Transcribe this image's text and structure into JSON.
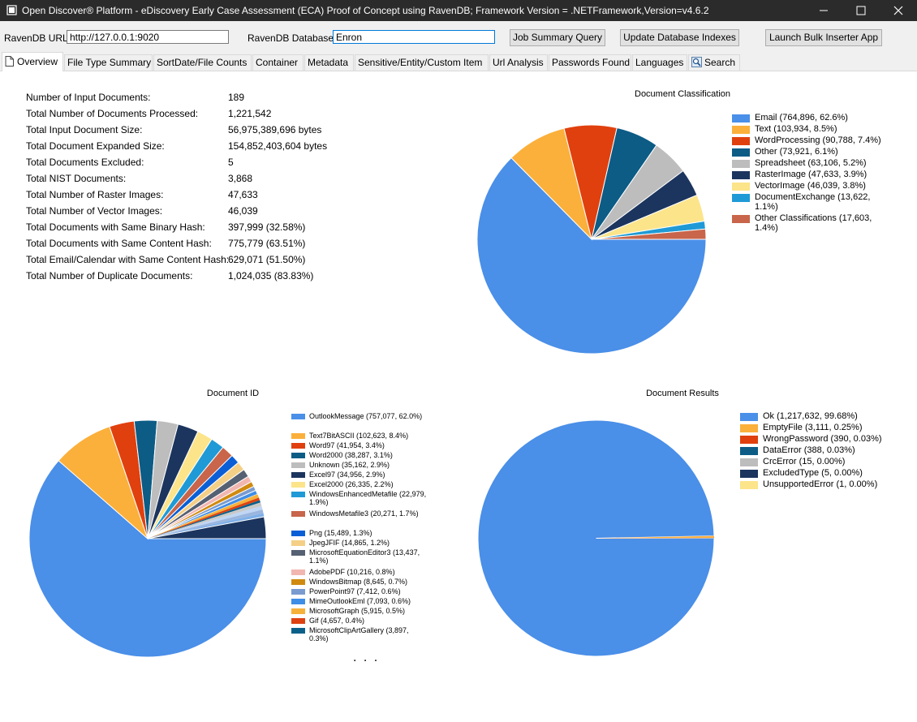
{
  "window": {
    "title": "Open Discover® Platform - eDiscovery Early Case Assessment (ECA) Proof of Concept using RavenDB;   Framework Version = .NETFramework,Version=v4.6.2"
  },
  "toolbar": {
    "ravendb_url_label": "RavenDB URL:",
    "ravendb_url_value": "http://127.0.0.1:9020",
    "ravendb_db_label": "RavenDB Database:",
    "ravendb_db_value": "Enron",
    "job_summary_button": "Job Summary Query",
    "update_indexes_button": "Update Database Indexes",
    "bulk_inserter_button": "Launch Bulk Inserter App"
  },
  "tabs": [
    {
      "label": "Overview",
      "icon": "document-icon",
      "active": true
    },
    {
      "label": "File Type Summary"
    },
    {
      "label": "SortDate/File Counts"
    },
    {
      "label": "Container"
    },
    {
      "label": "Metadata"
    },
    {
      "label": "Sensitive/Entity/Custom Item"
    },
    {
      "label": "Url Analysis"
    },
    {
      "label": "Passwords Found"
    },
    {
      "label": "Languages"
    },
    {
      "label": "Search",
      "icon": "search-icon"
    }
  ],
  "stats": [
    {
      "label": "Number of Input Documents:",
      "value": "189"
    },
    {
      "label": "Total Number of Documents Processed:",
      "value": "1,221,542"
    },
    {
      "label": "Total Input Document Size:",
      "value": "56,975,389,696 bytes"
    },
    {
      "label": "Total Document Expanded Size:",
      "value": "154,852,403,604 bytes"
    },
    {
      "label": "Total Documents Excluded:",
      "value": "5"
    },
    {
      "label": "Total NIST Documents:",
      "value": "3,868"
    },
    {
      "label": "Total Number of Raster Images:",
      "value": "47,633"
    },
    {
      "label": "Total Number of Vector Images:",
      "value": "46,039"
    },
    {
      "label": "Total Documents with Same Binary Hash:",
      "value": "397,999 (32.58%)"
    },
    {
      "label": "Total Documents with Same Content Hash:",
      "value": "775,779 (63.51%)"
    },
    {
      "label": "Total Email/Calendar with Same Content Hash:",
      "value": "629,071 (51.50%)"
    },
    {
      "label": "Total Number of Duplicate Documents:",
      "value": "1,024,035 (83.83%)"
    }
  ],
  "chart_data": [
    {
      "type": "pie",
      "title": "Document Classification",
      "legend": "right",
      "series": [
        {
          "name": "Email",
          "value": 764896,
          "label": "Email (764,896, 62.6%)",
          "color": "#4a8fe8"
        },
        {
          "name": "Text",
          "value": 103934,
          "label": "Text (103,934, 8.5%)",
          "color": "#fbb03b"
        },
        {
          "name": "WordProcessing",
          "value": 90788,
          "label": "WordProcessing (90,788, 7.4%)",
          "color": "#e0400e"
        },
        {
          "name": "Other",
          "value": 73921,
          "label": "Other (73,921, 6.1%)",
          "color": "#0c5c86"
        },
        {
          "name": "Spreadsheet",
          "value": 63106,
          "label": "Spreadsheet (63,106, 5.2%)",
          "color": "#bdbdbd"
        },
        {
          "name": "RasterImage",
          "value": 47633,
          "label": "RasterImage (47,633, 3.9%)",
          "color": "#1c355e"
        },
        {
          "name": "VectorImage",
          "value": 46039,
          "label": "VectorImage (46,039, 3.8%)",
          "color": "#fce48a"
        },
        {
          "name": "DocumentExchange",
          "value": 13622,
          "label": "DocumentExchange (13,622, 1.1%)",
          "color": "#1f9ad6"
        },
        {
          "name": "Other Classifications",
          "value": 17603,
          "label": "Other Classifications (17,603, 1.4%)",
          "color": "#c8654a"
        }
      ]
    },
    {
      "type": "pie",
      "title": "Document ID",
      "legend": "right",
      "series": [
        {
          "name": "OutlookMessage",
          "value": 757077,
          "label": "OutlookMessage (757,077, 62.0%)",
          "color": "#4a8fe8"
        },
        {
          "name": "Text7BitASCII",
          "value": 102623,
          "label": "Text7BitASCII (102,623, 8.4%)",
          "color": "#fbb03b"
        },
        {
          "name": "Word97",
          "value": 41954,
          "label": "Word97 (41,954, 3.4%)",
          "color": "#e0400e"
        },
        {
          "name": "Word2000",
          "value": 38287,
          "label": "Word2000 (38,287, 3.1%)",
          "color": "#0c5c86"
        },
        {
          "name": "Unknown",
          "value": 35162,
          "label": "Unknown (35,162, 2.9%)",
          "color": "#bdbdbd"
        },
        {
          "name": "Excel97",
          "value": 34956,
          "label": "Excel97 (34,956, 2.9%)",
          "color": "#1c355e"
        },
        {
          "name": "Excel2000",
          "value": 26335,
          "label": "Excel2000 (26,335, 2.2%)",
          "color": "#fce48a"
        },
        {
          "name": "WindowsEnhancedMetafile",
          "value": 22979,
          "label": "WindowsEnhancedMetafile (22,979, 1.9%)",
          "color": "#1f9ad6"
        },
        {
          "name": "WindowsMetafile3",
          "value": 20271,
          "label": "WindowsMetafile3 (20,271, 1.7%)",
          "color": "#c8654a"
        },
        {
          "name": "Png",
          "value": 15489,
          "label": "Png (15,489, 1.3%)",
          "color": "#0b5fd6"
        },
        {
          "name": "JpegJFIF",
          "value": 14865,
          "label": "JpegJFIF (14,865, 1.2%)",
          "color": "#f4cf86"
        },
        {
          "name": "MicrosoftEquationEditor3",
          "value": 13437,
          "label": "MicrosoftEquationEditor3 (13,437, 1.1%)",
          "color": "#556172"
        },
        {
          "name": "AdobePDF",
          "value": 10216,
          "label": "AdobePDF (10,216, 0.8%)",
          "color": "#f2b6b0"
        },
        {
          "name": "WindowsBitmap",
          "value": 8645,
          "label": "WindowsBitmap (8,645, 0.7%)",
          "color": "#d08a10"
        },
        {
          "name": "PowerPoint97",
          "value": 7412,
          "label": "PowerPoint97 (7,412, 0.6%)",
          "color": "#7a9bd0"
        },
        {
          "name": "MimeOutlookEml",
          "value": 7093,
          "label": "MimeOutlookEml (7,093, 0.6%)",
          "color": "#3f8ee6"
        },
        {
          "name": "MicrosoftGraph",
          "value": 5915,
          "label": "MicrosoftGraph (5,915, 0.5%)",
          "color": "#f6b13b"
        },
        {
          "name": "Gif",
          "value": 4657,
          "label": "Gif (4,657, 0.4%)",
          "color": "#de4212"
        },
        {
          "name": "MicrosoftClipArtGallery",
          "value": 3897,
          "label": "MicrosoftClipArtGallery (3,897, 0.3%)",
          "color": "#0b6089"
        }
      ],
      "remaining_segments_colors": [
        "#c9c9c9",
        "#bfd6f4",
        "#9bb6de",
        "#7fb0e8",
        "#1c355e"
      ],
      "more_indicator": ". . ."
    },
    {
      "type": "pie",
      "title": "Document Results",
      "legend": "right",
      "series": [
        {
          "name": "Ok",
          "value": 1217632,
          "label": "Ok (1,217,632, 99.68%)",
          "color": "#4a8fe8"
        },
        {
          "name": "EmptyFile",
          "value": 3111,
          "label": "EmptyFile (3,111, 0.25%)",
          "color": "#fbb03b"
        },
        {
          "name": "WrongPassword",
          "value": 390,
          "label": "WrongPassword (390, 0.03%)",
          "color": "#e0400e"
        },
        {
          "name": "DataError",
          "value": 388,
          "label": "DataError (388, 0.03%)",
          "color": "#0c5c86"
        },
        {
          "name": "CrcError",
          "value": 15,
          "label": "CrcError (15, 0.00%)",
          "color": "#bdbdbd"
        },
        {
          "name": "ExcludedType",
          "value": 5,
          "label": "ExcludedType (5, 0.00%)",
          "color": "#1c355e"
        },
        {
          "name": "UnsupportedError",
          "value": 1,
          "label": "UnsupportedError (1, 0.00%)",
          "color": "#fce48a"
        }
      ]
    }
  ]
}
